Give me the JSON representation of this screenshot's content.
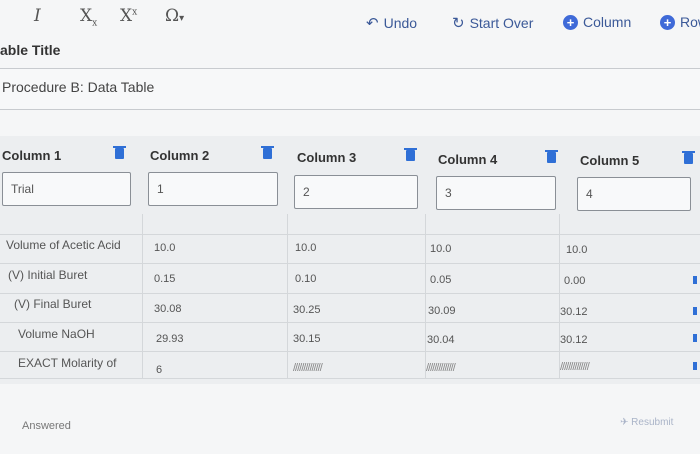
{
  "toolbar": {
    "italic": "I",
    "subscript": "X",
    "superscript": "X",
    "omega": "Ω",
    "undo": "Undo",
    "start_over": "Start Over",
    "add_column": "Column",
    "add_row": "Row"
  },
  "table_title": {
    "label": "able Title",
    "value": "Procedure B: Data Table"
  },
  "columns": [
    "Column 1",
    "Column 2",
    "Column 3",
    "Column 4",
    "Column 5"
  ],
  "trial_row": [
    "Trial",
    "1",
    "2",
    "3",
    "4"
  ],
  "rows": [
    {
      "label": "Volume of Acetic Acid",
      "values": [
        "10.0",
        "10.0",
        "10.0",
        "10.0"
      ]
    },
    {
      "label": "(V) Initial Buret",
      "values": [
        "0.15",
        "0.10",
        "0.05",
        "0.00"
      ]
    },
    {
      "label": "(V) Final Buret",
      "values": [
        "30.08",
        "30.25",
        "30.09",
        "30.12"
      ]
    },
    {
      "label": "Volume NaOH",
      "values": [
        "29.93",
        "30.15",
        "30.04",
        "30.12"
      ]
    },
    {
      "label": "EXACT Molarity of",
      "values": [
        "6",
        "//////////////",
        "//////////////",
        "//////////////"
      ]
    }
  ],
  "footer": {
    "answered": "Answered",
    "resubmit": "Resubmit"
  },
  "colors": {
    "accent": "#3f6ad8",
    "trash": "#2f6fd6"
  }
}
